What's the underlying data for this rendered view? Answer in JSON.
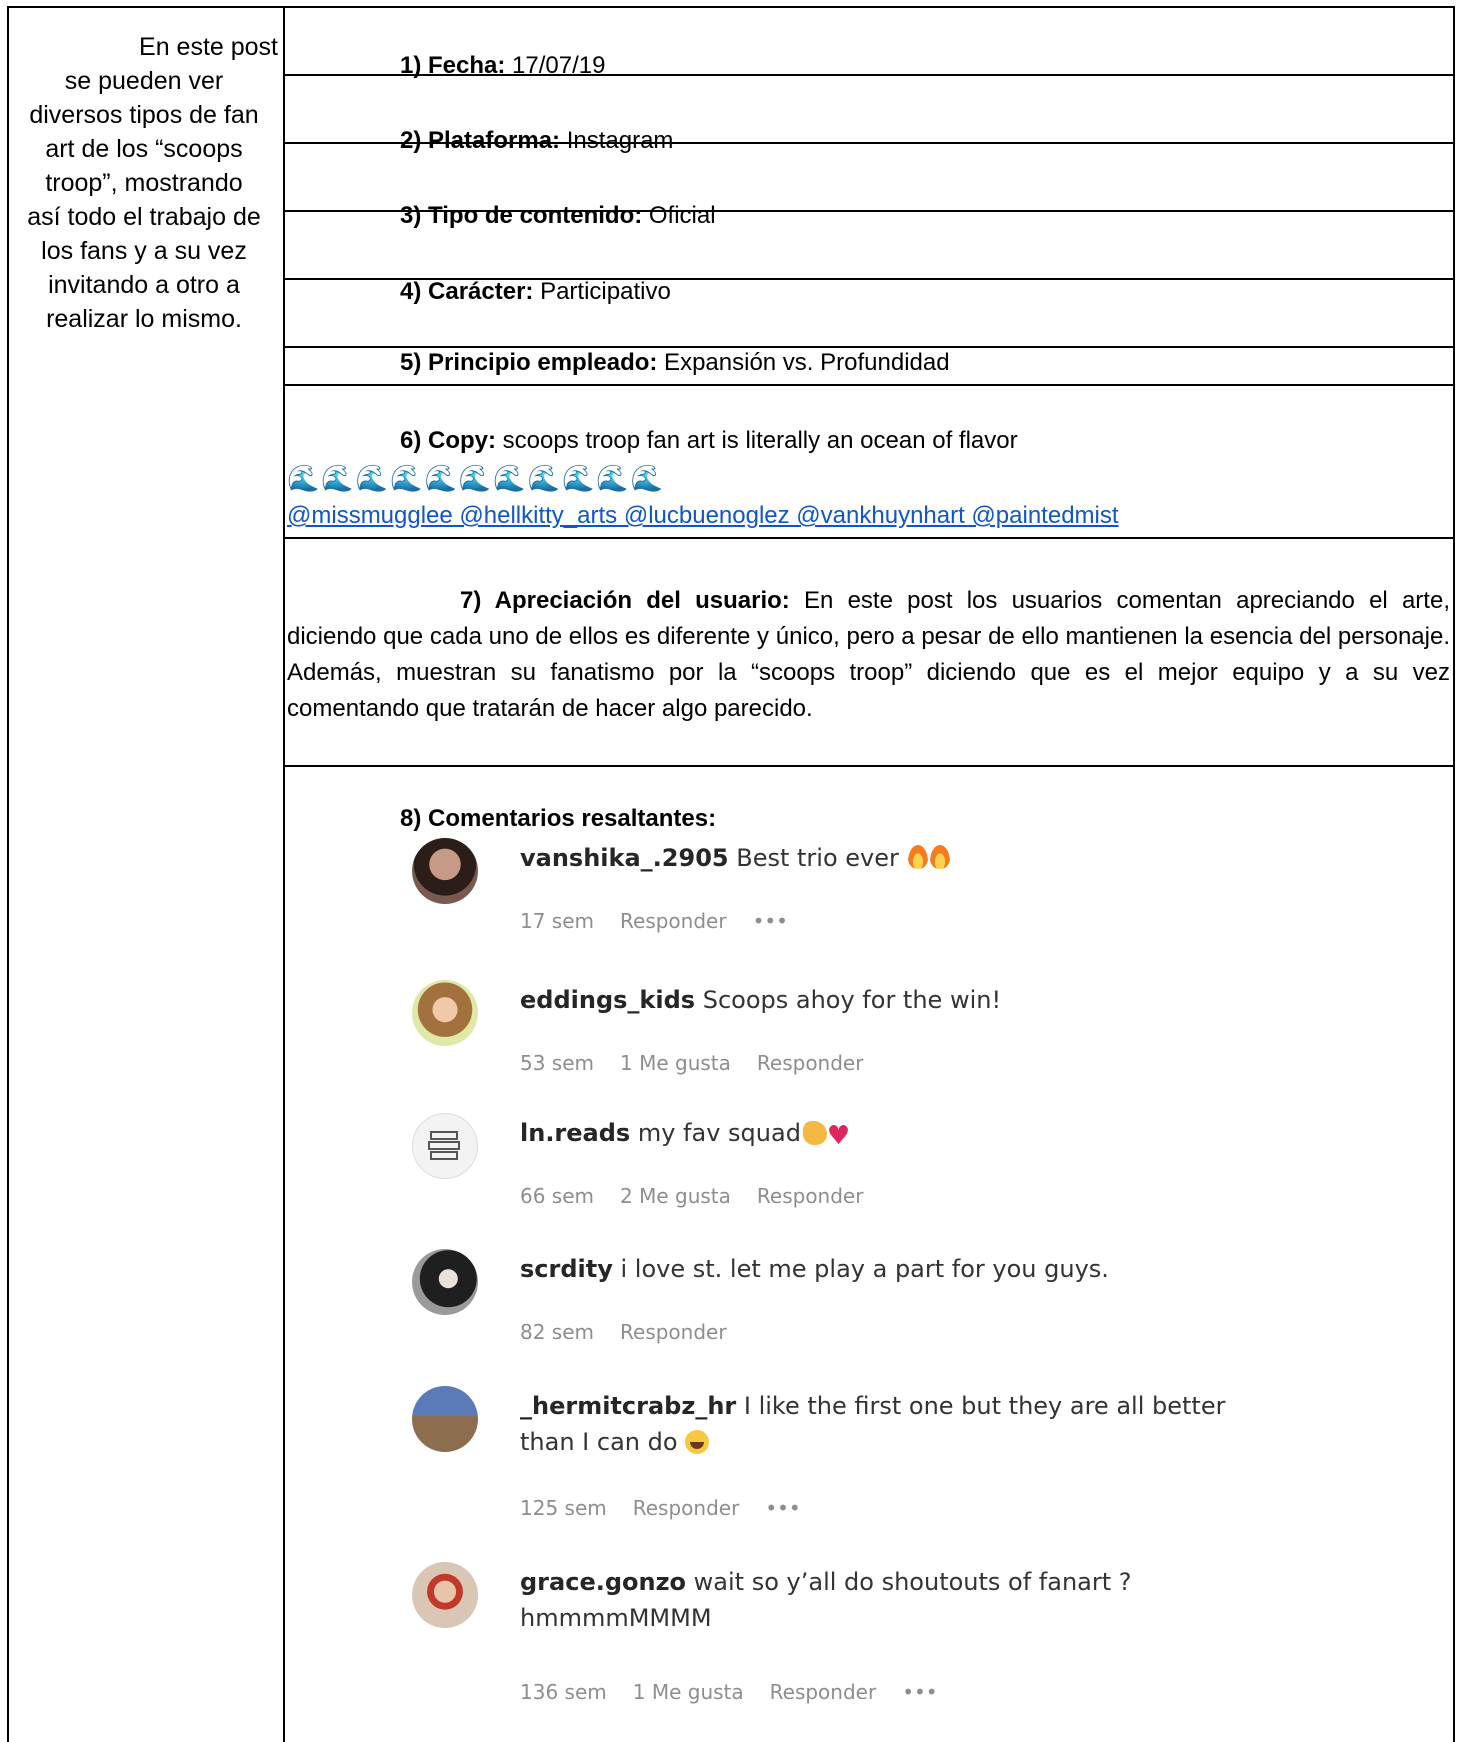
{
  "left_column": {
    "lines": [
      "En este post",
      "se pueden ver",
      "diversos tipos de fan",
      "art de los “scoops",
      "troop”, mostrando",
      "así todo el trabajo de",
      "los fans y a su vez",
      "invitando a otro a",
      "realizar lo mismo."
    ]
  },
  "rows": {
    "fecha": {
      "label": "1) Fecha:",
      "value": " 17/07/19"
    },
    "plataforma": {
      "label": "2) Plataforma:",
      "value": " Instagram"
    },
    "tipo": {
      "label": "3) Tipo de contenido:",
      "value": " Oficial"
    },
    "caracter": {
      "label": "4) Carácter:",
      "value": " Participativo"
    },
    "principio": {
      "label": "5) Principio empleado:",
      "value": " Expansión vs. Profundidad"
    },
    "copy": {
      "label": "6) Copy:",
      "value": " scoops troop fan art is literally an ocean of flavor",
      "emoji": "🌊🌊🌊🌊🌊🌊🌊🌊🌊🌊🌊",
      "mentions": "@missmugglee @hellkitty_arts @lucbuenoglez @vankhuynhart @paintedmist"
    },
    "apreciacion": {
      "label": "7) Apreciación del usuario:",
      "value": " En este post los usuarios comentan apreciando el arte, diciendo que cada uno de ellos es diferente y único, pero a pesar de ello mantienen la esencia del personaje. Además, muestran su fanatismo por la “scoops troop” diciendo que es el mejor equipo y a su vez comentando que tratarán de hacer algo parecido."
    },
    "comentarios_title": "8) Comentarios resaltantes:"
  },
  "comments": [
    {
      "user": "vanshika_.2905",
      "text": " Best trio ever ",
      "emoji": "fire-fire",
      "time": "17 sem",
      "likes": "",
      "reply": "Responder",
      "more": "•••",
      "avatar_color": "#5a3d32"
    },
    {
      "user": "eddings_kids",
      "text": " Scoops ahoy for the win!",
      "emoji": "",
      "time": "53 sem",
      "likes": "1 Me gusta",
      "reply": "Responder",
      "more": "",
      "avatar_color": "#d8b38a"
    },
    {
      "user": "ln.reads",
      "text": " my fav squad",
      "emoji": "clap-heart",
      "time": "66 sem",
      "likes": "2 Me gusta",
      "reply": "Responder",
      "more": "",
      "avatar_color": "#e8e8e8"
    },
    {
      "user": "scrdity",
      "text": " i love st. let me play a part for you guys.",
      "emoji": "",
      "time": "82 sem",
      "likes": "",
      "reply": "Responder",
      "more": "",
      "avatar_color": "#3a3a3a"
    },
    {
      "user": "_hermitcrabz_hr",
      "text": " I like the first one but they are all better than I can do ",
      "emoji": "laugh",
      "time": "125 sem",
      "likes": "",
      "reply": "Responder",
      "more": "•••",
      "avatar_color": "#6d7fa8"
    },
    {
      "user": "grace.gonzo",
      "text": " wait so y’all do shoutouts of fanart ? hmmmmMMMM",
      "emoji": "",
      "time": "136 sem",
      "likes": "1 Me gusta",
      "reply": "Responder",
      "more": "•••",
      "avatar_color": "#c9a58c"
    }
  ]
}
